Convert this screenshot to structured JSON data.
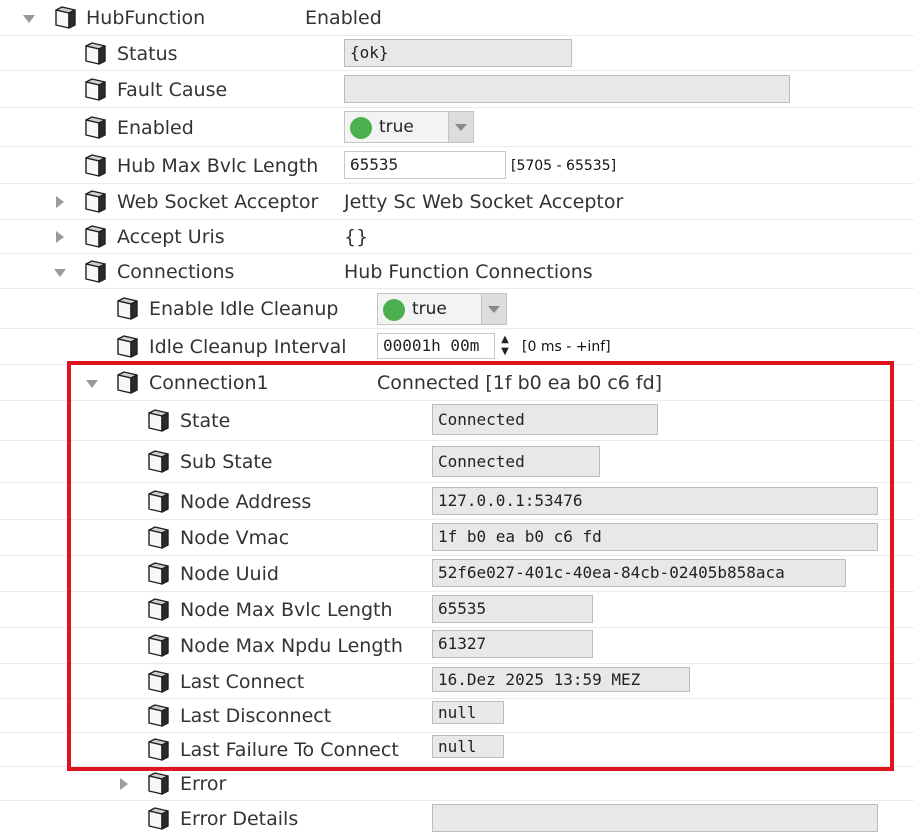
{
  "hub_function": {
    "label": "HubFunction",
    "value": "Enabled",
    "expanded": true
  },
  "status": {
    "label": "Status",
    "value": "{ok}"
  },
  "fault_cause": {
    "label": "Fault Cause",
    "value": ""
  },
  "enabled": {
    "label": "Enabled",
    "value": "true"
  },
  "hub_max_bvlc": {
    "label": "Hub Max Bvlc Length",
    "value": "65535",
    "range": "[5705 - 65535]"
  },
  "web_socket_acceptor": {
    "label": "Web Socket Acceptor",
    "value": "Jetty Sc Web Socket Acceptor"
  },
  "accept_uris": {
    "label": "Accept Uris",
    "value": "{}"
  },
  "connections": {
    "label": "Connections",
    "value": "Hub Function Connections",
    "expanded": true
  },
  "enable_idle_cleanup": {
    "label": "Enable Idle Cleanup",
    "value": "true"
  },
  "idle_cleanup_interval": {
    "label": "Idle Cleanup Interval",
    "value": "00001h 00m",
    "spin_up": "▲",
    "spin_down": "▼",
    "range": "[0 ms - +inf]"
  },
  "connection1": {
    "label": "Connection1",
    "value": "Connected [1f b0 ea b0 c6 fd]",
    "expanded": true,
    "state": {
      "label": "State",
      "value": "Connected"
    },
    "sub_state": {
      "label": "Sub State",
      "value": "Connected"
    },
    "node_address": {
      "label": "Node Address",
      "value": "127.0.0.1:53476"
    },
    "node_vmac": {
      "label": "Node Vmac",
      "value": "1f b0 ea b0 c6 fd"
    },
    "node_uuid": {
      "label": "Node Uuid",
      "value": "52f6e027-401c-40ea-84cb-02405b858aca"
    },
    "node_max_bvlc": {
      "label": "Node Max Bvlc Length",
      "value": "65535"
    },
    "node_max_npdu": {
      "label": "Node Max Npdu Length",
      "value": "61327"
    },
    "last_connect": {
      "label": "Last Connect",
      "value": "16.Dez 2025 13:59 MEZ"
    },
    "last_disconnect": {
      "label": "Last Disconnect",
      "value": "null"
    },
    "last_failure": {
      "label": "Last Failure To Connect",
      "value": "null"
    }
  },
  "error": {
    "label": "Error",
    "expanded": false
  },
  "error_details": {
    "label": "Error Details",
    "value": ""
  },
  "colors": {
    "highlight": "#e0141e",
    "true_indicator": "#4caf50",
    "field_bg": "#e8e8e8"
  },
  "icons": {
    "node": "cube-icon",
    "expand": "triangle-down-icon",
    "collapse": "triangle-right-icon"
  }
}
